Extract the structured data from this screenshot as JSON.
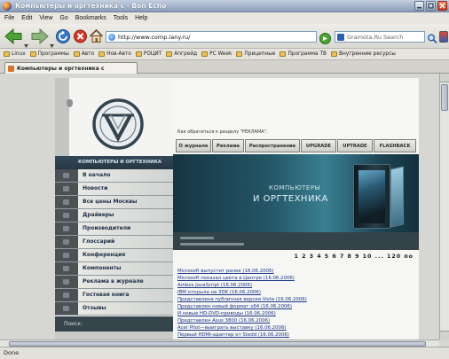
{
  "window": {
    "title": "Компьютеры и оргтехника с - Bon Echo"
  },
  "menu": {
    "items": [
      "File",
      "Edit",
      "View",
      "Go",
      "Bookmarks",
      "Tools",
      "Help"
    ]
  },
  "nav": {
    "address": "http://www.comp.iany.ru/",
    "search_engine": "Gramota.Ru Search"
  },
  "bookmarks": {
    "items": [
      "Linux",
      "Программы",
      "Авто",
      "Нов-Авто",
      "РОЦИТ",
      "Апгрейд",
      "PC Week",
      "Прицепные",
      "Программа ТВ",
      "Внутренние ресурсы"
    ]
  },
  "tab": {
    "label": "Компьютеры и оргтехника с"
  },
  "page": {
    "notice": "Как обратиться к разделу \"РЕКЛАМА\".",
    "top_nav": [
      "О журнале",
      "Реклама",
      "Распространение",
      "UPGRADE",
      "UPTRADE",
      "FLASHBACK"
    ],
    "sidebar_header": "КОМПЬЮТЕРЫ И ОРГТЕХНИКА",
    "sidebar_items": [
      "В начало",
      "Новости",
      "Все цены Москвы",
      "Драйверы",
      "Производители",
      "Глоссарий",
      "Конференция",
      "Компоненты",
      "Реклама в журнале",
      "Гостевая книга",
      "Отзывы"
    ],
    "search_label": "Поиск:",
    "banner_line1": "КОМПЬЮТЕРЫ",
    "banner_line2": "И ОРГТЕХНИКА",
    "pagination": "1 2 3 4 5 6 7 8 9 10 ... 120 по",
    "news": [
      "Microsoft выпустит ранее (16.06.2006)",
      "Microsoft показал цвета в Центре (16.06.2006)",
      "Ambos JavaScript (16.06.2006)",
      "IBM открыла на 3DK (16.06.2006)",
      "Представлена публичная версия Vista (16.06.2006)",
      "Представлен новый формат x64 (16.06.2006)",
      "И новые HD-DVD-приводы (16.06.2006)",
      "Представлен Asus 3800 (16.06.2006)",
      "Acer Pilot—выиграть выставку (16.06.2006)",
      "Первый HDMI-адаптер от Stedd (16.06.2006)"
    ]
  },
  "status": {
    "text": "Done"
  },
  "colors": {
    "titlebar": "#8b9eb9",
    "sidebar_header": "#263741",
    "banner": "#245767",
    "link": "#1f3a8a",
    "close_button": "#c8381c"
  },
  "icons": [
    "browser-logo-icon",
    "back-arrow-icon",
    "forward-arrow-icon",
    "reload-icon",
    "stop-icon",
    "home-icon",
    "globe-favicon",
    "go-arrow-icon",
    "search-engine-icon",
    "magnifier-icon",
    "folder-icon",
    "site-logo-icon",
    "pc-tower-image"
  ]
}
